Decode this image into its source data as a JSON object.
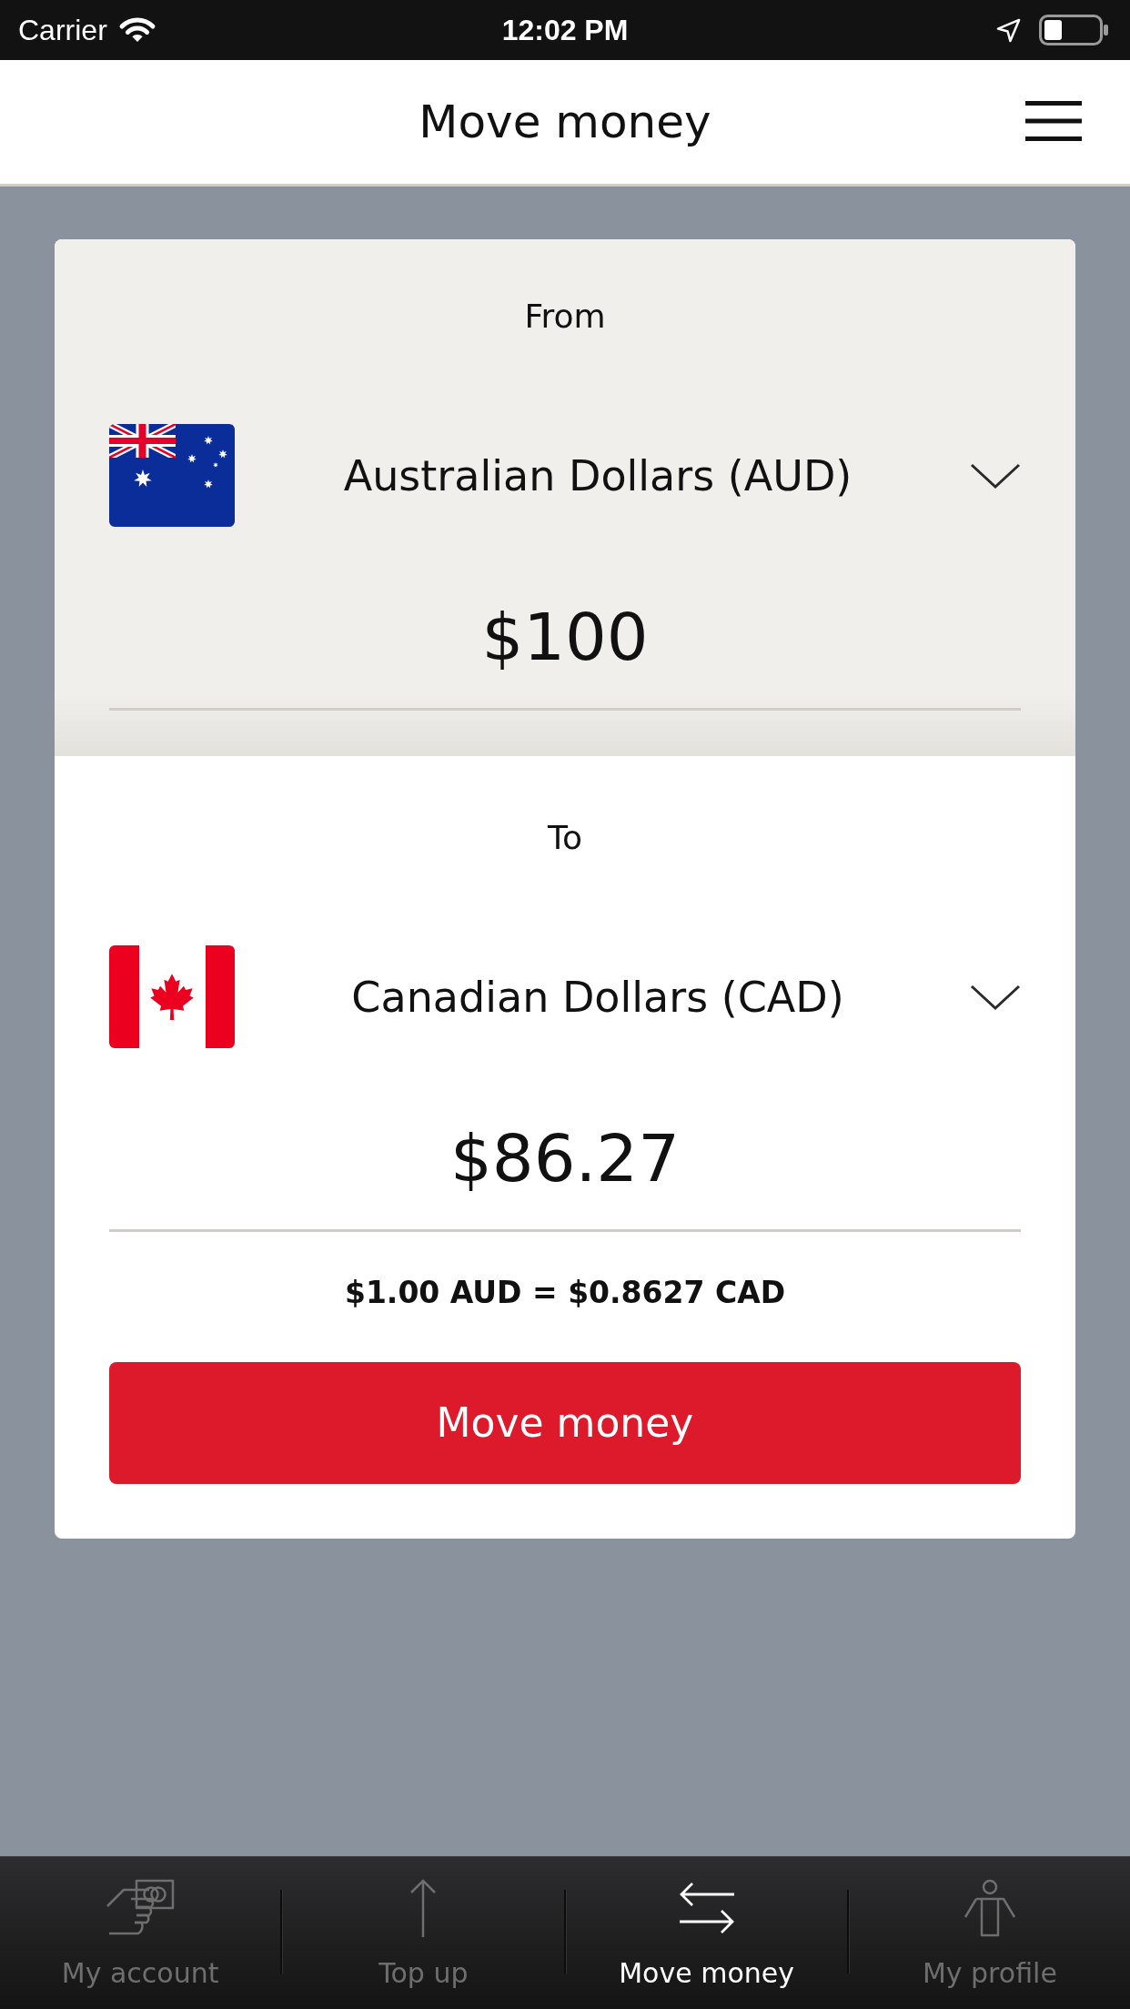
{
  "status_bar": {
    "carrier": "Carrier",
    "time": "12:02 PM"
  },
  "header": {
    "title": "Move money"
  },
  "transfer": {
    "from": {
      "label": "From",
      "currency": "Australian Dollars (AUD)",
      "amount": "$100"
    },
    "to": {
      "label": "To",
      "currency": "Canadian Dollars (CAD)",
      "amount": "$86.27"
    },
    "rate": "$1.00 AUD = $0.8627 CAD",
    "button": "Move money"
  },
  "tab_bar": {
    "tabs": [
      {
        "label": "My account",
        "selected": false
      },
      {
        "label": "Top up",
        "selected": false
      },
      {
        "label": "Move money",
        "selected": true
      },
      {
        "label": "My profile",
        "selected": false
      }
    ]
  }
}
